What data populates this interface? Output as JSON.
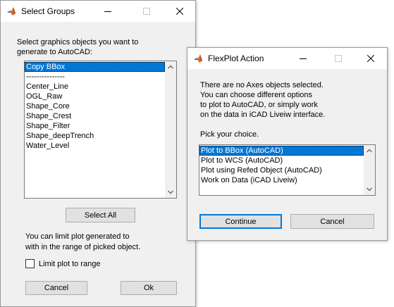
{
  "select_groups": {
    "title": "Select Groups",
    "instructions_line1": "Select graphics objects you want to",
    "instructions_line2": "generate to AutoCAD:",
    "items": [
      "Copy BBox",
      "---------------",
      "Center_Line",
      "OGL_Raw",
      "Shape_Core",
      "Shape_Crest",
      "Shape_Filter",
      "Shape_deepTrench",
      "Water_Level"
    ],
    "selected_item": "Copy BBox",
    "select_all_label": "Select All",
    "limit_note_line1": "You can limit plot generated to",
    "limit_note_line2": "with in the range of picked object.",
    "limit_checkbox_label": "Limit plot to range",
    "limit_checked": false,
    "cancel_label": "Cancel",
    "ok_label": "Ok"
  },
  "flexplot": {
    "title": "FlexPlot Action",
    "message_line1": "There are no Axes objects selected.",
    "message_line2": "You can choose different options",
    "message_line3": "to plot to AutoCAD, or simply work",
    "message_line4": "on the data in iCAD Liveiw interface.",
    "prompt": "Pick your choice.",
    "options": [
      "Plot to BBox (AutoCAD)",
      "Plot to WCS (AutoCAD)",
      "Plot using Refed Object (AutoCAD)",
      "Work on Data (iCAD Liveiw)"
    ],
    "selected_option": "Plot to BBox (AutoCAD)",
    "continue_label": "Continue",
    "cancel_label": "Cancel"
  },
  "colors": {
    "selection": "#0078d7",
    "window_bg": "#f0f0f0",
    "button_bg": "#e1e1e1"
  },
  "icons": {
    "app": "matlab-icon",
    "minimize": "minimize-icon",
    "maximize": "maximize-icon",
    "close": "close-icon"
  }
}
